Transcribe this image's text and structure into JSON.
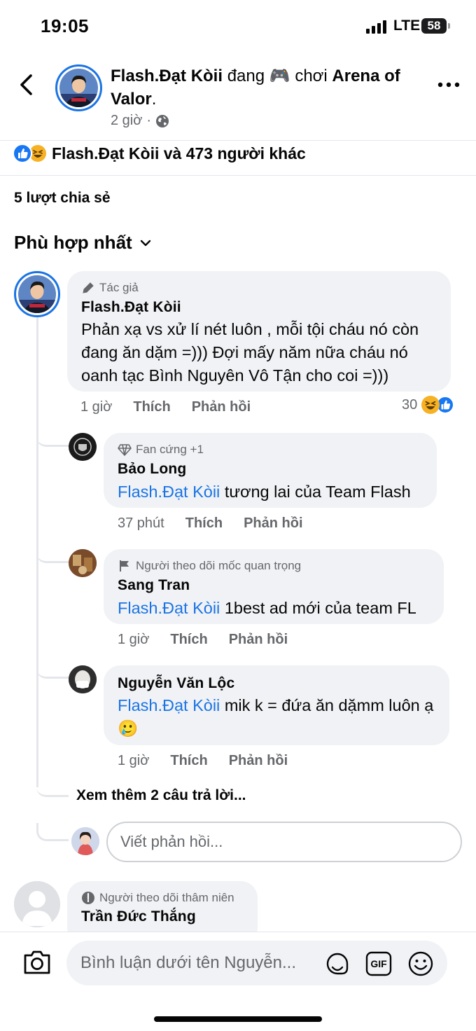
{
  "status_bar": {
    "time": "19:05",
    "network": "LTE",
    "battery": "58"
  },
  "post": {
    "author": "Flash.Đạt Kòii",
    "activity_verb": "đang 🎮 chơi",
    "activity_target": "Arena of Valor",
    "title_suffix": ".",
    "time": "2 giờ",
    "separator": "·"
  },
  "reactions": {
    "summary": "Flash.Đạt Kòii và 473 người khác"
  },
  "shares": "5 lượt chia sẻ",
  "sort_label": "Phù hợp nhất",
  "comments": [
    {
      "badge": "Tác giả",
      "name": "Flash.Đạt Kòii",
      "text": "Phản xạ vs xử lí nét luôn , mỗi tội cháu nó còn đang ăn dặm =))) Đợi mấy năm nữa cháu nó oanh tạc Bình Nguyên Vô Tận cho coi =)))",
      "time": "1 giờ",
      "like_label": "Thích",
      "reply_label": "Phản hồi",
      "reaction_count": "30"
    }
  ],
  "replies": [
    {
      "badge": "Fan cứng +1",
      "name": "Bảo Long",
      "mention": "Flash.Đạt Kòii",
      "text": "tương lai của Team Flash",
      "time": "37 phút",
      "like_label": "Thích",
      "reply_label": "Phản hồi"
    },
    {
      "badge": "Người theo dõi mốc quan trọng",
      "name": "Sang Tran",
      "mention": "Flash.Đạt Kòii",
      "text": "1best ad mới của team FL",
      "time": "1 giờ",
      "like_label": "Thích",
      "reply_label": "Phản hồi"
    },
    {
      "badge": "",
      "name": "Nguyễn Văn Lộc",
      "mention": "Flash.Đạt Kòii",
      "text": "mik k = đứa ăn dặmm luôn ạ🥲",
      "time": "1 giờ",
      "like_label": "Thích",
      "reply_label": "Phản hồi"
    }
  ],
  "see_more_replies": "Xem thêm 2 câu trả lời...",
  "reply_placeholder": "Viết phản hồi...",
  "next_comment": {
    "badge": "Người theo dõi thâm niên",
    "name": "Trần Đức Thắng"
  },
  "composer": {
    "placeholder": "Bình luận dưới tên Nguyễn..."
  },
  "colors": {
    "accent": "#1b74e4",
    "bubble": "#f0f2f5",
    "secondary_text": "#65676b"
  },
  "icons": [
    "back-icon",
    "more-icon",
    "globe-icon",
    "like-icon",
    "haha-icon",
    "chevron-down-icon",
    "pencil-icon",
    "diamond-icon",
    "flag-icon",
    "shield-icon",
    "camera-icon",
    "sticker-icon",
    "gif-icon",
    "emoji-icon"
  ]
}
